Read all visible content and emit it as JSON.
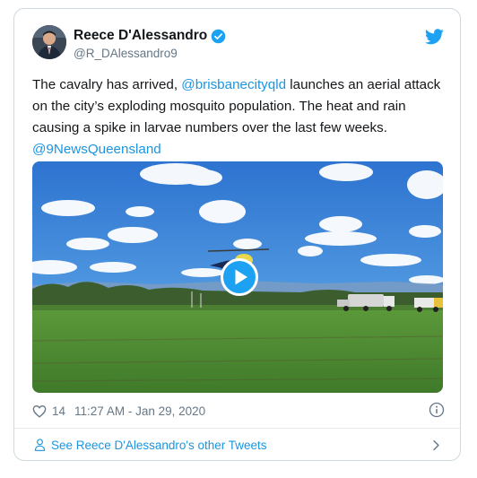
{
  "tweet": {
    "author_name": "Reece D'Alessandro",
    "author_handle": "@R_DAlessandro9",
    "text_before_mention": "The cavalry has arrived, ",
    "mention_1": "@brisbanecityqld",
    "text_after_mention": " launches an aerial attack on the city’s exploding mosquito population. The heat and rain causing a spike in larvae numbers over the last few weeks.",
    "mention_2": "@9NewsQueensland",
    "like_count": "14",
    "timestamp": "11:27 AM - Jan 29, 2020"
  },
  "footer": {
    "see_more_label": "See Reece D'Alessandro's other Tweets"
  },
  "colors": {
    "link": "#1b95e0",
    "secondary_text": "#657786",
    "verified": "#1da1f2",
    "border": "#cfd9de"
  },
  "icons": {
    "verified": "verified-badge-icon",
    "brand": "twitter-bird-icon",
    "like": "heart-icon",
    "info": "info-icon",
    "media_play": "play-icon",
    "footer": "person-icon",
    "footer_arrow": "chevron-right-icon"
  }
}
